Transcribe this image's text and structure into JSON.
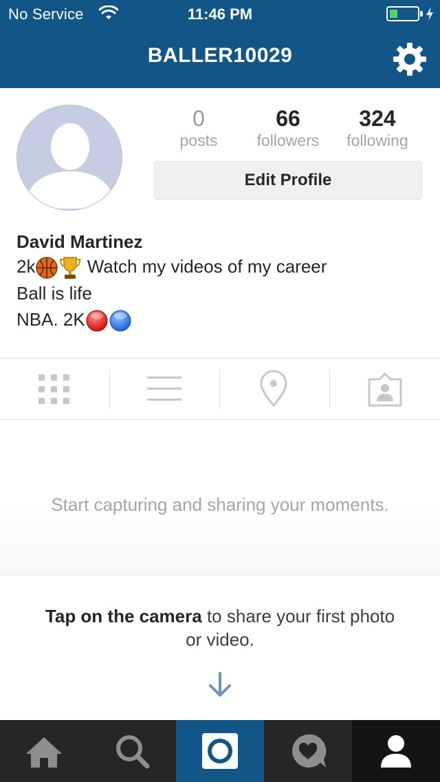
{
  "status_bar": {
    "carrier": "No Service",
    "time": "11:46 PM",
    "battery_level": 0.3,
    "icons": [
      "wifi-icon",
      "battery-icon",
      "charging-bolt-icon"
    ]
  },
  "nav": {
    "title": "BALLER10029",
    "settings_icon": "gear-icon"
  },
  "profile": {
    "stats": [
      {
        "value": "0",
        "label": "posts"
      },
      {
        "value": "66",
        "label": "followers"
      },
      {
        "value": "324",
        "label": "following"
      }
    ],
    "edit_button": "Edit Profile",
    "name": "David Martinez",
    "bio": {
      "line1_prefix": "2k",
      "line1_text": "Watch my videos of my career",
      "line1_emojis": [
        "basketball-emoji",
        "trophy-emoji"
      ],
      "line2": "Ball is life",
      "line3_text": "NBA. 2K",
      "line3_emojis": [
        "red-circle-emoji",
        "blue-circle-emoji"
      ]
    }
  },
  "view_tabs": [
    "grid-icon",
    "list-icon",
    "location-pin-icon",
    "tagged-photos-icon"
  ],
  "empty_state": {
    "message": "Start capturing and sharing your moments.",
    "hint_bold": "Tap on the camera",
    "hint_rest": "to share your first photo or video."
  },
  "tab_bar": {
    "items": [
      "home-icon",
      "search-icon",
      "camera-icon",
      "activity-icon",
      "profile-icon"
    ],
    "active": "profile-icon"
  },
  "colors": {
    "header": "#125688",
    "tab_bar": "#262626",
    "battery": "#4cd964",
    "bio_text": "#262626",
    "muted_text": "#a5a5a5"
  }
}
